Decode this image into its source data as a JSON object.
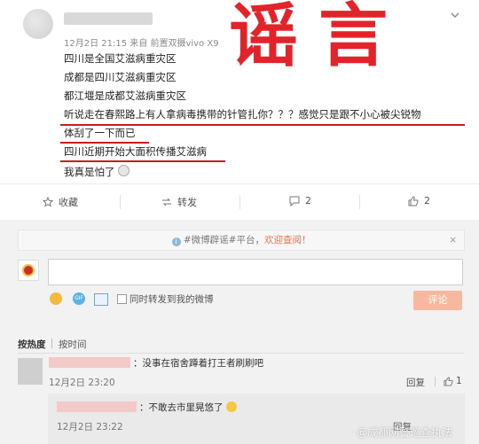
{
  "post": {
    "meta": "12月2日 21:15 来自 前置双摄vivo X9",
    "lines": [
      "四川是全国艾滋病重灾区",
      "成都是四川艾滋病重灾区",
      "都江堰是成都艾滋病重灾区",
      "听说走在春熙路上有人拿病毒携带的针管扎你？？？感觉只是跟不小心被尖锐物",
      "体刮了一下而已",
      "四川近期开始大面积传播艾滋病",
      "我真是怕了"
    ],
    "stamp": "谣 言"
  },
  "actions": {
    "collect": "收藏",
    "forward": "转发",
    "comment_count": "2",
    "like_count": "2"
  },
  "comments_panel": {
    "notice_prefix": "#微博辟谣#平台，",
    "notice_link": "欢迎查阅！",
    "also_forward": "同时转发到我的微博",
    "submit": "评论",
    "sort_hot": "按热度",
    "sort_time": "按时间"
  },
  "comments": [
    {
      "text": "：没事在宿舍蹲着打王者刷刷吧",
      "time": "12月2日 23:20",
      "reply": "回复",
      "likes": "1"
    }
  ],
  "reply": {
    "text": "：不敢去市里晃悠了",
    "time": "12月2日 23:22",
    "reply": "回复"
  },
  "watermark": "@成都网警巡查执法",
  "colors": {
    "stamp": "#e3232a",
    "underline": "#c41e25",
    "accent": "#eb7350"
  }
}
